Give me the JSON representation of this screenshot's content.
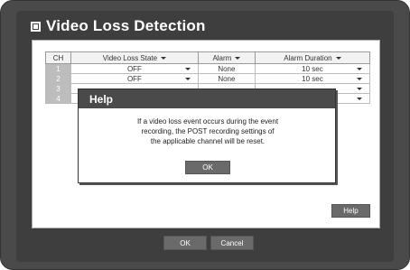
{
  "page": {
    "title": "Video Loss Detection"
  },
  "table": {
    "headers": {
      "ch": "CH",
      "state": "Video Loss State",
      "alarm": "Alarm",
      "duration": "Alarm Duration"
    },
    "rows": [
      {
        "ch": "1",
        "state": "OFF",
        "alarm": "None",
        "duration": "10 sec"
      },
      {
        "ch": "2",
        "state": "OFF",
        "alarm": "None",
        "duration": "10 sec"
      },
      {
        "ch": "3",
        "state": "",
        "alarm": "",
        "duration": ""
      },
      {
        "ch": "4",
        "state": "",
        "alarm": "",
        "duration": ""
      }
    ]
  },
  "buttons": {
    "help": "Help",
    "ok": "OK",
    "cancel": "Cancel"
  },
  "dialog": {
    "title": "Help",
    "message_lines": [
      "If a video loss event occurs during the event",
      "recording, the POST recording settings of",
      "the applicable channel will be reset."
    ],
    "ok": "OK"
  },
  "colors": {
    "frame": "#4a4a4a",
    "button": "#6a6a6a",
    "channel_cell": "#bdbdbd"
  }
}
